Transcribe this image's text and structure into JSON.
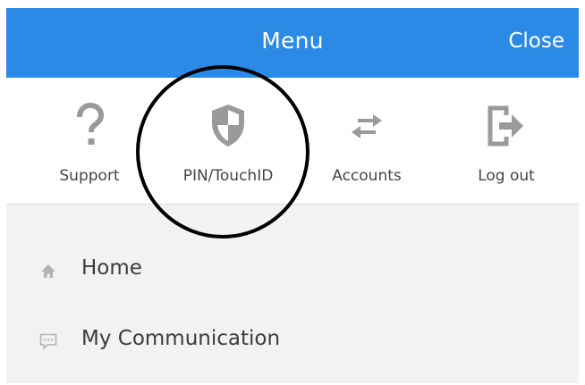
{
  "header": {
    "title": "Menu",
    "close_label": "Close",
    "color": "#2b8ae6"
  },
  "toolbar": {
    "items": [
      {
        "label": "Support",
        "icon": "question-mark-icon"
      },
      {
        "label": "PIN/TouchID",
        "icon": "shield-icon"
      },
      {
        "label": "Accounts",
        "icon": "swap-arrows-icon"
      },
      {
        "label": "Log out",
        "icon": "logout-icon"
      }
    ],
    "icon_color": "#9a9a9a"
  },
  "menu": {
    "items": [
      {
        "label": "Home",
        "icon": "home-icon"
      },
      {
        "label": "My Communication",
        "icon": "chat-bubble-icon"
      }
    ]
  },
  "annotation": {
    "shape": "circle",
    "highlights": "PIN/TouchID"
  }
}
